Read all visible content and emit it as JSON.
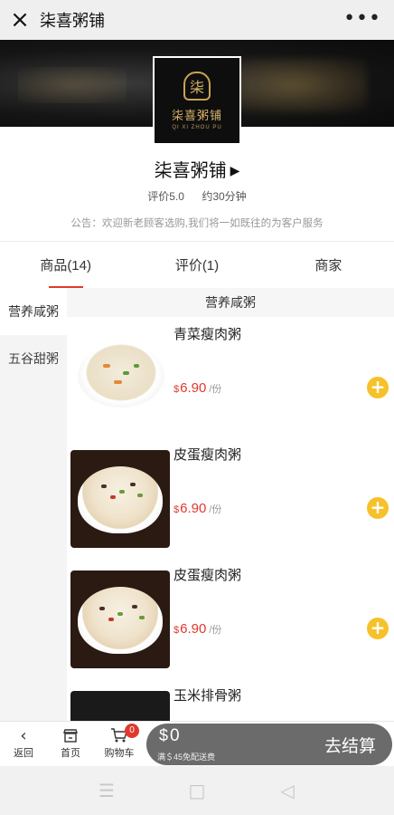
{
  "topbar": {
    "close_icon": "×",
    "title": "柒喜粥铺",
    "more_icon": "•••"
  },
  "logo": {
    "glyph": "柒",
    "name": "柒喜粥铺",
    "pinyin": "QI XI ZHOU PU"
  },
  "shop": {
    "name": "柒喜粥铺",
    "arrow": "▶",
    "rating": "评价5.0",
    "delivery_time": "约30分钟",
    "notice": "公告：欢迎新老顾客选购,我们将一如既往的为客户服务"
  },
  "tabs": [
    {
      "label": "商品(14)",
      "active": true
    },
    {
      "label": "评价(1)",
      "active": false
    },
    {
      "label": "商家",
      "active": false
    }
  ],
  "categories": [
    {
      "label": "营养咸粥",
      "active": true
    },
    {
      "label": "五谷甜粥",
      "active": false
    }
  ],
  "section_title": "营养咸粥",
  "items": [
    {
      "name": "青菜瘦肉粥",
      "currency": "$",
      "price": "6.90",
      "unit": "/份"
    },
    {
      "name": "皮蛋瘦肉粥",
      "currency": "$",
      "price": "6.90",
      "unit": "/份"
    },
    {
      "name": "皮蛋瘦肉粥",
      "currency": "$",
      "price": "6.90",
      "unit": "/份"
    },
    {
      "name": "玉米排骨粥",
      "currency": "$",
      "price": "",
      "unit": ""
    }
  ],
  "bottom_nav": {
    "back": {
      "icon": "‹",
      "label": "返回"
    },
    "home": {
      "label": "首页"
    },
    "cart": {
      "label": "购物车",
      "badge": "0"
    }
  },
  "checkout": {
    "currency": "$",
    "amount": "0",
    "free_delivery": "满＄45免配送费",
    "button": "去结算"
  },
  "system_nav": {
    "menu_icon": "☰",
    "home_icon": "□",
    "back_icon": "◁"
  },
  "colors": {
    "accent": "#e0392e",
    "add_button": "#f6c12a",
    "checkout_bg": "#6b6b6b"
  }
}
